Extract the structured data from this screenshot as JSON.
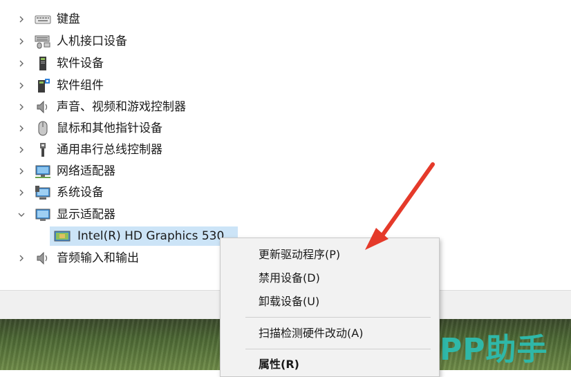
{
  "tree": {
    "items": [
      {
        "label": "键盘",
        "icon": "keyboard-icon",
        "expanded": false
      },
      {
        "label": "人机接口设备",
        "icon": "hid-icon",
        "expanded": false
      },
      {
        "label": "软件设备",
        "icon": "software-device-icon",
        "expanded": false
      },
      {
        "label": "软件组件",
        "icon": "software-component-icon",
        "expanded": false
      },
      {
        "label": "声音、视频和游戏控制器",
        "icon": "speaker-icon",
        "expanded": false
      },
      {
        "label": "鼠标和其他指针设备",
        "icon": "mouse-icon",
        "expanded": false
      },
      {
        "label": "通用串行总线控制器",
        "icon": "usb-icon",
        "expanded": false
      },
      {
        "label": "网络适配器",
        "icon": "network-adapter-icon",
        "expanded": false
      },
      {
        "label": "系统设备",
        "icon": "system-device-icon",
        "expanded": false
      },
      {
        "label": "显示适配器",
        "icon": "display-adapter-icon",
        "expanded": true
      },
      {
        "label": "Intel(R) HD Graphics 530",
        "icon": "display-adapter-icon",
        "child": true,
        "selected": true
      },
      {
        "label": "音频输入和输出",
        "icon": "speaker-icon",
        "expanded": false
      }
    ]
  },
  "context_menu": {
    "items": [
      {
        "label": "更新驱动程序(P)"
      },
      {
        "label": "禁用设备(D)"
      },
      {
        "label": "卸载设备(U)"
      },
      {
        "label": "扫描检测硬件改动(A)"
      },
      {
        "label": "属性(R)",
        "bold": true
      }
    ]
  },
  "watermark": "PP助手",
  "colors": {
    "selection": "#cce4f7",
    "arrow": "#e53a2a",
    "watermark": "#2fb8a8"
  }
}
